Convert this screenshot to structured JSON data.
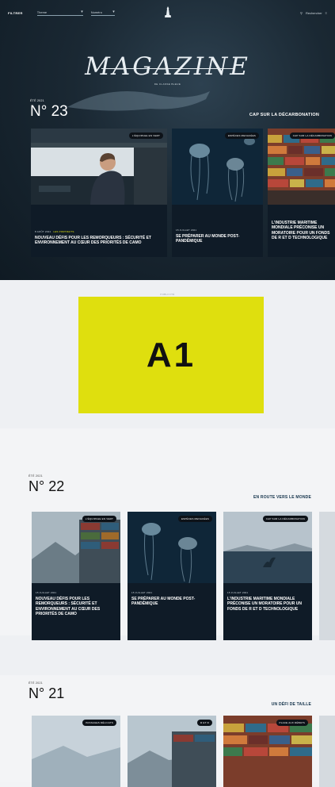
{
  "topbar": {
    "brand": "FILTRER",
    "filter1": "Theme",
    "filter2": "Numéro",
    "right_label": "Rechercher"
  },
  "hero": {
    "title": "MAGAZINE",
    "subtitle": "DE CLASSE BLEUE",
    "issue_date": "ÉTÉ 2021",
    "issue_number": "N° 23",
    "theme": "CAP SUR LA DÉCARBONATION",
    "cards": [
      {
        "tag": "L'ÉQUIPAGE EN VERT",
        "date": "8 AOÛT 2021",
        "highlight": "LES PORTRAITS",
        "title": "NOUVEAU DÉFIS POUR LES REMORQUEURS : SÉCURITÉ ET ENVIRONNEMENT AU CŒUR DES PRIORITÉS DE CAMO"
      },
      {
        "tag": "ESPÈCES MENACÉES",
        "date": "15 JUILLET 2021",
        "highlight": "",
        "title": "SE PRÉPARER AU MONDE POST-PANDÉMIQUE"
      },
      {
        "tag": "CAP SUR LA DÉCARBONATION",
        "date": "",
        "highlight": "",
        "title": "L'INDUSTRIE MARITIME MONDIALE PRÉCONISE UN MORATOIRE POUR UN FONDS DE R ET D TECHNOLOGIQUE"
      }
    ]
  },
  "ad": {
    "label": "PUBLICITÉ",
    "text": "A1"
  },
  "issue22": {
    "issue_date": "ÉTÉ 2021",
    "issue_number": "N° 22",
    "theme": "EN ROUTE VERS LE MONDE",
    "cards": [
      {
        "tag": "L'ÉQUIPAGE EN VERT",
        "date": "15 JUILLET 2021",
        "title": "NOUVEAU DÉFIS POUR LES REMORQUEURS : SÉCURITÉ ET ENVIRONNEMENT AU CŒUR DES PRIORITÉS DE CAMO"
      },
      {
        "tag": "ESPÈCES MENACÉES",
        "date": "15 JUILLET 2021",
        "title": "SE PRÉPARER AU MONDE POST-PANDÉMIQUE"
      },
      {
        "tag": "CAP SUR LA DÉCARBONATION",
        "date": "15 JUILLET 2021",
        "title": "L'INDUSTRIE MARITIME MONDIALE PRÉCONISE UN MORATOIRE POUR UN FONDS DE R ET D TECHNOLOGIQUE"
      }
    ]
  },
  "issue21": {
    "issue_date": "ÉTÉ 2021",
    "issue_number": "N° 21",
    "theme": "UN DÉFI DE TAILLE",
    "cards": [
      {
        "tag": "PASSAGES DÉLICATS"
      },
      {
        "tag": "R ET D"
      },
      {
        "tag": "PLACE AUX DÉBATS"
      }
    ]
  },
  "colors": {
    "accent_yellow": "#dfdf0e",
    "navy": "#13324a",
    "card_bg": "#0f1b27"
  }
}
